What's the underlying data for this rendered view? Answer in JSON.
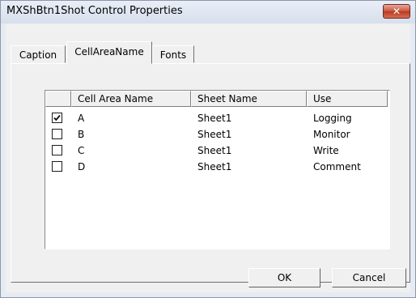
{
  "window": {
    "title": "MXShBtn1Shot Control Properties",
    "close_glyph": "✕"
  },
  "tabs": [
    {
      "label": "Caption",
      "selected": false
    },
    {
      "label": "CellAreaName",
      "selected": true
    },
    {
      "label": "Fonts",
      "selected": false
    }
  ],
  "list": {
    "columns": [
      "",
      "Cell Area Name",
      "Sheet Name",
      "Use"
    ],
    "rows": [
      {
        "checked": true,
        "name": "A",
        "sheet": "Sheet1",
        "use": "Logging"
      },
      {
        "checked": false,
        "name": "B",
        "sheet": "Sheet1",
        "use": "Monitor"
      },
      {
        "checked": false,
        "name": "C",
        "sheet": "Sheet1",
        "use": "Write"
      },
      {
        "checked": false,
        "name": "D",
        "sheet": "Sheet1",
        "use": "Comment"
      }
    ]
  },
  "buttons": {
    "ok": "OK",
    "cancel": "Cancel"
  }
}
